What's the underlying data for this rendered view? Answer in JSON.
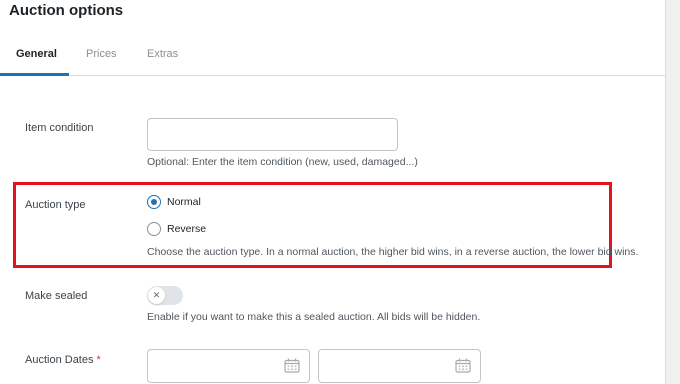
{
  "panel": {
    "title": "Auction options"
  },
  "tabs": [
    {
      "label": "General",
      "active": true
    },
    {
      "label": "Prices",
      "active": false
    },
    {
      "label": "Extras",
      "active": false
    }
  ],
  "item_condition": {
    "label": "Item condition",
    "value": "",
    "description": "Optional: Enter the item condition (new, used, damaged...)"
  },
  "auction_type": {
    "label": "Auction type",
    "options": [
      {
        "label": "Normal",
        "checked": true
      },
      {
        "label": "Reverse",
        "checked": false
      }
    ],
    "description": "Choose the auction type. In a normal auction, the higher bid wins, in a reverse auction, the lower bid wins."
  },
  "make_sealed": {
    "label": "Make sealed",
    "enabled": false,
    "description": "Enable if you want to make this a sealed auction. All bids will be hidden."
  },
  "auction_dates": {
    "label": "Auction Dates",
    "required_marker": "*",
    "start_value": "",
    "end_value": ""
  },
  "colors": {
    "accent": "#2271b1",
    "highlight_border": "#e1141d",
    "required": "#d63638"
  },
  "icons": {
    "radio_checked": "radio-checked-icon",
    "toggle_off": "close-icon",
    "calendar": "calendar-icon"
  }
}
